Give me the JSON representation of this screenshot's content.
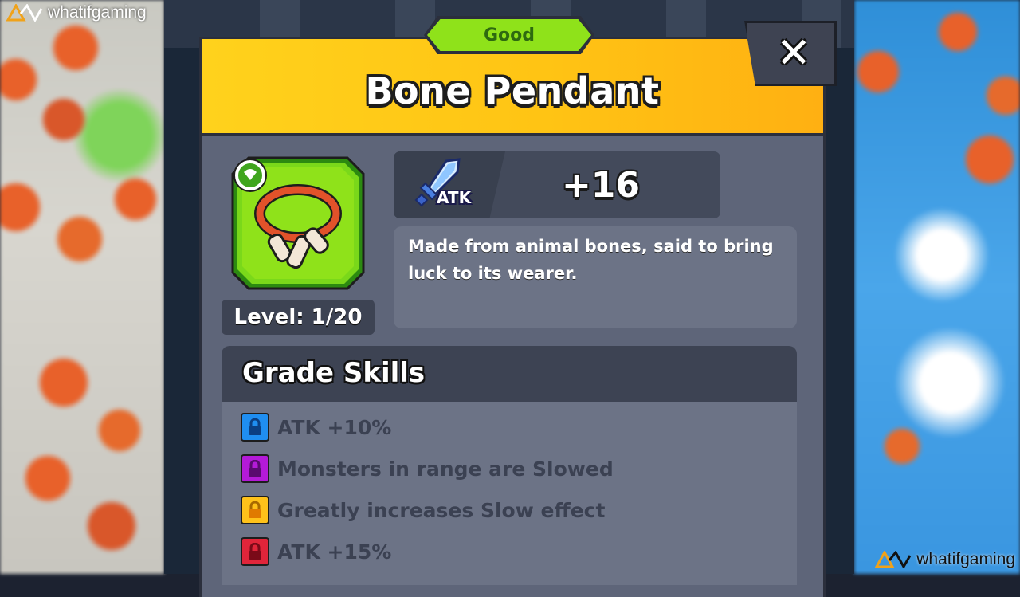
{
  "watermark": {
    "brand": "whatifgaming"
  },
  "dialog": {
    "grade": "Good",
    "title": "Bone Pendant",
    "close_icon": "close-icon"
  },
  "item": {
    "icon": "bone-pendant-icon",
    "level_text": "Level: 1/20",
    "stat": {
      "icon": "sword-icon",
      "label": "ATK",
      "value": "+16"
    },
    "description": "Made from animal bones, said to bring luck to its wearer."
  },
  "skills": {
    "title": "Grade Skills",
    "items": [
      {
        "text": "ATK +10%",
        "lock_color": "#1f8ef0",
        "locked": true
      },
      {
        "text": "Monsters in range are Slowed",
        "lock_color": "#b41ad8",
        "locked": true
      },
      {
        "text": "Greatly increases Slow effect",
        "lock_color": "#ffc21a",
        "locked": true
      },
      {
        "text": "ATK +15%",
        "lock_color": "#e0253a",
        "locked": true
      }
    ]
  },
  "colors": {
    "header_yellow": "#ffc414",
    "grade_green": "#8fe21a",
    "panel": "#5e6579"
  }
}
